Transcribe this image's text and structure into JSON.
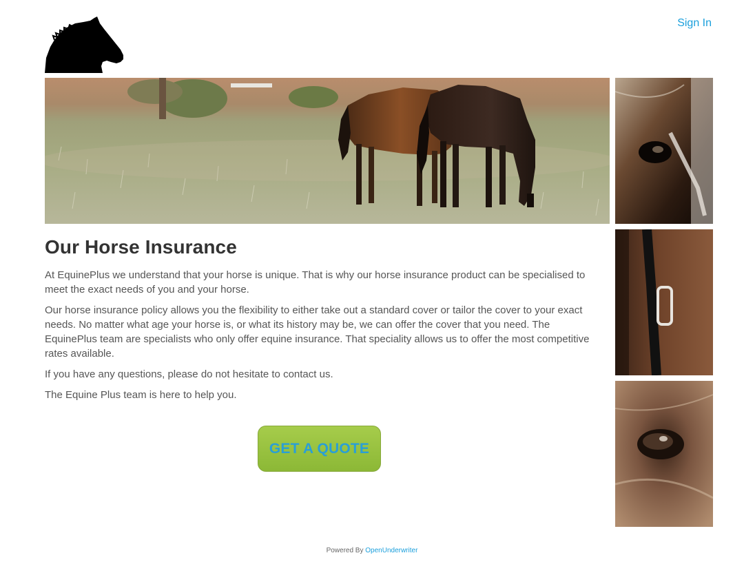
{
  "header": {
    "logo_icon": "horse-head-icon",
    "sign_in_label": "Sign In"
  },
  "images": {
    "hero": "horses-grazing-photo",
    "thumb_1": "horse-eye-closeup-photo",
    "thumb_2": "horse-bridle-closeup-photo",
    "thumb_3": "horse-eye-macro-photo"
  },
  "main": {
    "title": "Our Horse Insurance",
    "paragraphs": [
      "At EquinePlus we understand that your horse is unique. That is why our horse insurance product can be specialised to meet the exact needs of you and your horse.",
      "Our horse insurance policy allows you the flexibility to either take out a standard cover or tailor the cover to your exact needs. No matter what age your horse is, or what its history may be, we can offer the cover that you need. The EquinePlus team are specialists who only offer equine insurance. That speciality allows us to offer the most competitive rates available.",
      "If you have any questions, please do not hesitate to contact us.",
      "The Equine Plus team is here to help you."
    ],
    "cta_label": "GET A QUOTE"
  },
  "footer": {
    "prefix": "Powered By ",
    "link_label": "OpenUnderwriter"
  },
  "colors": {
    "link": "#1a9fdc",
    "button_green": "#9bc442",
    "button_text": "#2a9fd6"
  }
}
